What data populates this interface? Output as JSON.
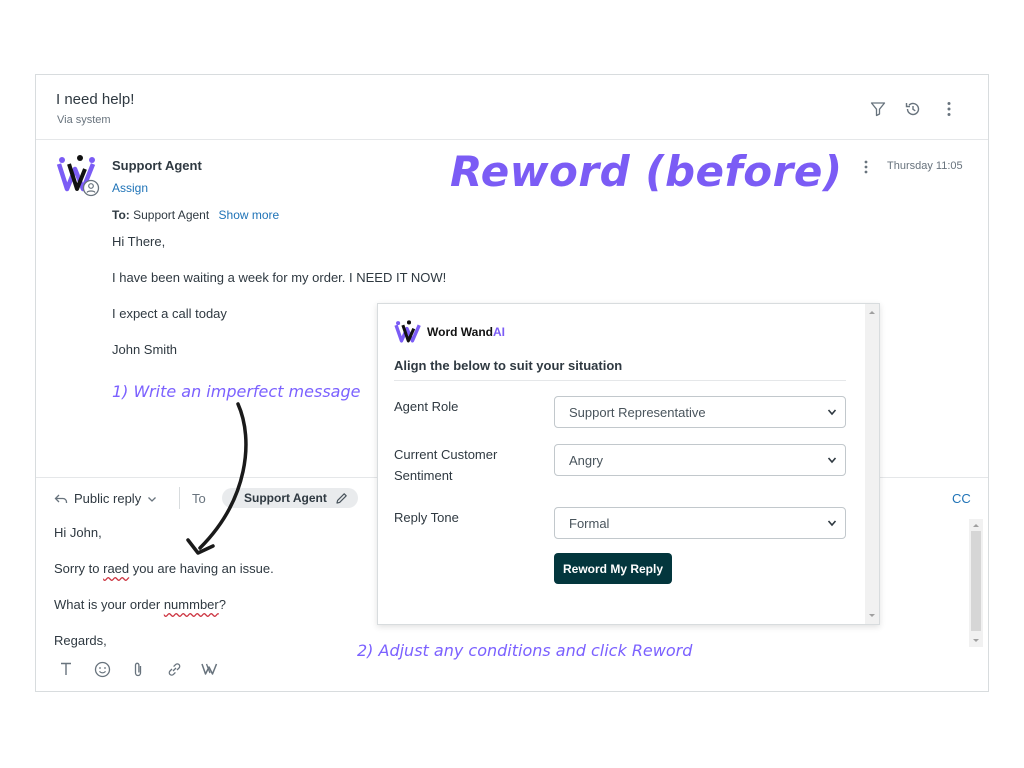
{
  "ticket": {
    "subject": "I need help!",
    "via": "Via system"
  },
  "message": {
    "author": "Support Agent",
    "assign_label": "Assign",
    "timestamp": "Thursday 11:05",
    "to_prefix": "To:",
    "to_name": "Support Agent",
    "show_more": "Show more",
    "lines": [
      "Hi There,",
      "I have been waiting a week for my order. I NEED IT NOW!",
      "I expect a call today",
      "John Smith"
    ]
  },
  "annotations": {
    "title": "Reword (before)",
    "step1": "1) Write an imperfect message",
    "step2": "2) Adjust any conditions and click Reword"
  },
  "reply": {
    "type_label": "Public reply",
    "to_label": "To",
    "recipient": "Support Agent",
    "cc_label": "CC",
    "greeting": "Hi John,",
    "line2_a": "Sorry to ",
    "line2_typo": "raed",
    "line2_b": " you are having an issue.",
    "line3_a": "What is your order ",
    "line3_typo": "nummber",
    "line3_b": "?",
    "signoff": "Regards,"
  },
  "wordwand": {
    "logo_word": "Word Wand",
    "logo_ai": "AI",
    "heading": "Align the below to suit your situation",
    "fields": [
      {
        "label": "Agent Role",
        "value": "Support Representative"
      },
      {
        "label": "Current Customer Sentiment",
        "value": "Angry"
      },
      {
        "label": "Reply Tone",
        "value": "Formal"
      }
    ],
    "button_label": "Reword My Reply"
  },
  "colors": {
    "accent_purple": "#7b5cf5",
    "link_blue": "#1f73b7",
    "button_dark": "#03363d",
    "typo_red": "#cc3340"
  },
  "icons": [
    "filter-icon",
    "history-icon",
    "more-vertical-icon",
    "reply-arrow-icon",
    "chevron-down-icon",
    "edit-pencil-icon",
    "text-format-icon",
    "emoji-icon",
    "attachment-icon",
    "link-icon",
    "wordwand-icon"
  ]
}
